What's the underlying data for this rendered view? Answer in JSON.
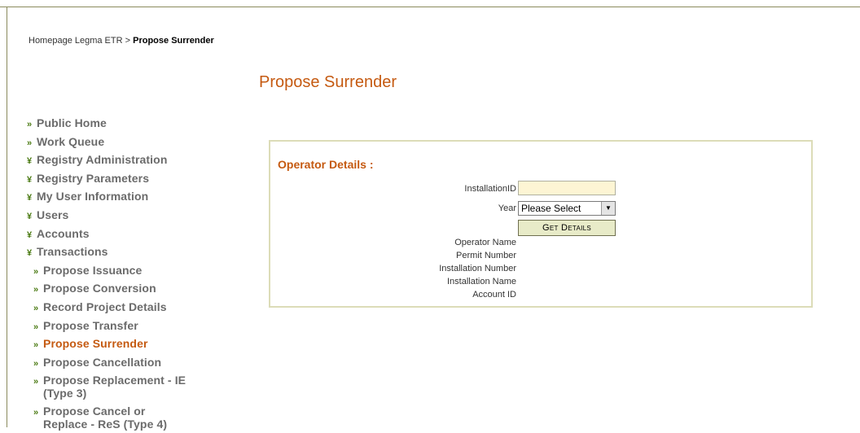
{
  "breadcrumb": {
    "home": "Homepage Legma ETR",
    "separator": ">",
    "current": "Propose Surrender"
  },
  "page": {
    "title": "Propose Surrender"
  },
  "nav": {
    "items": [
      {
        "bullet": "»",
        "label": "Public Home"
      },
      {
        "bullet": "»",
        "label": "Work Queue"
      },
      {
        "bullet": "¥",
        "label": "Registry Administration"
      },
      {
        "bullet": "¥",
        "label": "Registry Parameters"
      },
      {
        "bullet": "¥",
        "label": "My User Information"
      },
      {
        "bullet": "¥",
        "label": "Users"
      },
      {
        "bullet": "¥",
        "label": "Accounts"
      },
      {
        "bullet": "¥",
        "label": "Transactions"
      },
      {
        "bullet": "»",
        "label": "Propose Issuance"
      },
      {
        "bullet": "»",
        "label": "Propose Conversion"
      },
      {
        "bullet": "»",
        "label": "Record Project Details"
      },
      {
        "bullet": "»",
        "label": "Propose Transfer"
      },
      {
        "bullet": "»",
        "label": "Propose Surrender"
      },
      {
        "bullet": "»",
        "label": "Propose Cancellation"
      },
      {
        "bullet": "»",
        "label": "Propose Replacement - IE (Type 3)"
      },
      {
        "bullet": "»",
        "label": "Propose Cancel or Replace - ReS (Type 4)"
      }
    ]
  },
  "form": {
    "heading": "Operator Details :",
    "installation_id_label": "InstallationID",
    "installation_id_value": "",
    "year_label": "Year",
    "year_selected": "Please Select",
    "get_details_label": "Get Details",
    "operator_name_label": "Operator Name",
    "permit_number_label": "Permit Number",
    "installation_number_label": "Installation Number",
    "installation_name_label": "Installation Name",
    "account_id_label": "Account ID"
  },
  "colors": {
    "accent": "#c55a11",
    "nav_text": "#6b6b6b",
    "bullet": "#4a7a12",
    "panel_border": "#dcdcb8",
    "input_bg": "#fdf5d4"
  }
}
